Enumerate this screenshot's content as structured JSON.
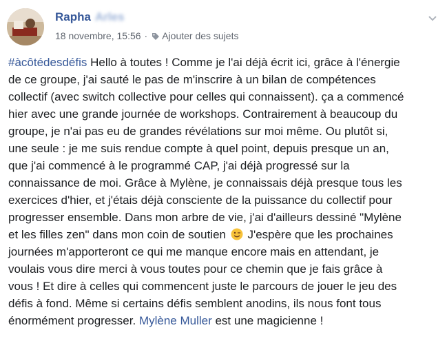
{
  "post": {
    "author_first": "Rapha",
    "author_last": "Arles",
    "date": "18 novembre, 15:56",
    "separator": "·",
    "add_topics": "Ajouter des sujets",
    "icons": {
      "tag": "tag-icon",
      "menu": "chevron-down-icon",
      "emoji": "winking-face-icon"
    },
    "colors": {
      "link": "#365899",
      "text": "#1c1e21",
      "meta": "#616770"
    },
    "hashtag": "#àcôtédesdéfis",
    "mention": "Mylène Muller",
    "lines": [
      " Hello à toutes ! Comme je l'ai déjà écrit ici, grâce à l'énergie",
      "de ce groupe, j'ai sauté le pas de m'inscrire à un bilan de compétences",
      "collectif (avec switch collective pour celles qui connaissent). ça a commencé",
      "hier avec une grande journée de workshops. Contrairement à beaucoup du",
      "groupe, je n'ai pas eu de grandes révélations sur moi même. Ou plutôt si,",
      "une seule : je me suis rendue compte à quel point, depuis presque un an,",
      "que j'ai commencé à le programmé CAP, j'ai déjà progressé sur la",
      "connaissance de moi. Grâce à Mylène, je connaissais déjà presque tous les",
      "exercices d'hier, et j'étais déjà consciente de la puissance du collectif pour",
      "progresser ensemble. Dans mon arbre de vie, j'ai d'ailleurs dessiné \"Mylène",
      "et les filles zen\" dans mon coin de soutien",
      " J'espère que les prochaines",
      "journées m'apporteront ce qui me manque encore mais en attendant, je",
      "voulais vous dire merci à vous toutes pour ce chemin que je fais grâce à",
      "vous ! Et dire à celles qui commencent juste le parcours de jouer le jeu des",
      "défis à fond. Même si certains défis semblent anodins, ils nous font tous",
      "énormément progresser.",
      " est une magicienne !"
    ]
  }
}
